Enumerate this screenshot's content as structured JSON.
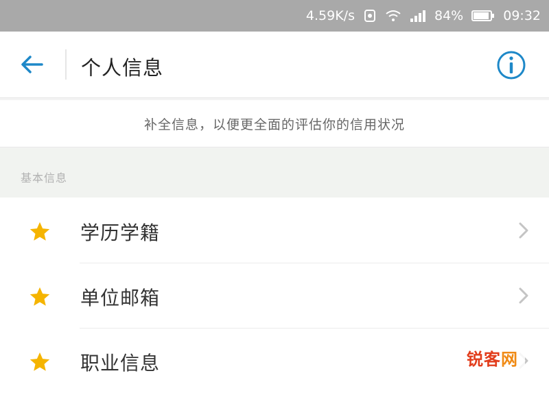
{
  "status_bar": {
    "net_speed": "4.59K/s",
    "battery": "84%",
    "time": "09:32"
  },
  "header": {
    "title": "个人信息"
  },
  "hint": "补全信息，以便更全面的评估你的信用状况",
  "section": {
    "title": "基本信息"
  },
  "items": [
    {
      "label": "学历学籍"
    },
    {
      "label": "单位邮箱"
    },
    {
      "label": "职业信息"
    }
  ],
  "watermark": {
    "part1": "锐客",
    "part2": "网"
  },
  "colors": {
    "accent": "#1e88c8",
    "star": "#f5b400",
    "status_bar": "#a9a9a9"
  }
}
